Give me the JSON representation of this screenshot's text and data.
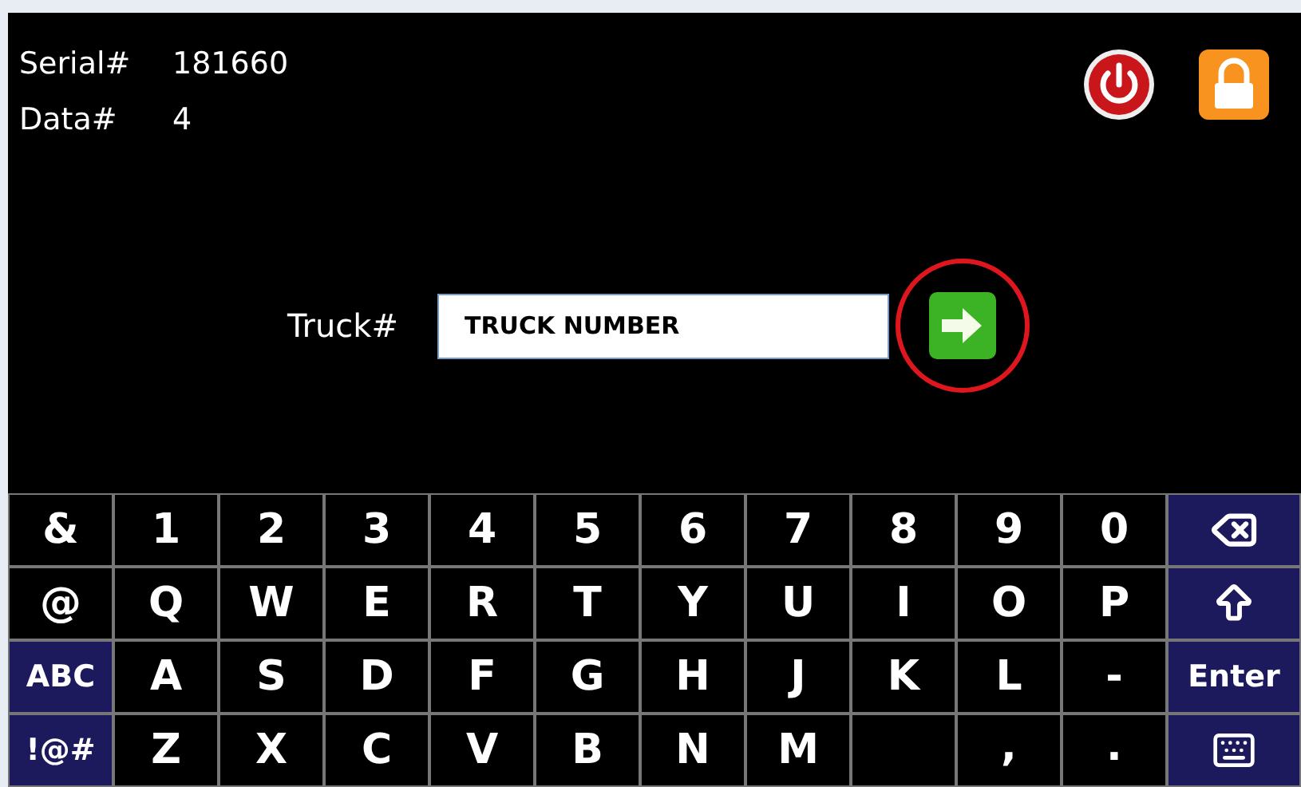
{
  "info": [
    {
      "label": "Serial#",
      "value": "181660"
    },
    {
      "label": "Data#",
      "value": "4"
    }
  ],
  "truck": {
    "label": "Truck#",
    "value": "TRUCK NUMBER"
  },
  "keyboard": [
    [
      {
        "kind": "char",
        "label": "&"
      },
      {
        "kind": "char",
        "label": "1"
      },
      {
        "kind": "char",
        "label": "2"
      },
      {
        "kind": "char",
        "label": "3"
      },
      {
        "kind": "char",
        "label": "4"
      },
      {
        "kind": "char",
        "label": "5"
      },
      {
        "kind": "char",
        "label": "6"
      },
      {
        "kind": "char",
        "label": "7"
      },
      {
        "kind": "char",
        "label": "8"
      },
      {
        "kind": "char",
        "label": "9"
      },
      {
        "kind": "char",
        "label": "0"
      },
      {
        "kind": "backspace"
      }
    ],
    [
      {
        "kind": "char",
        "label": "@"
      },
      {
        "kind": "char",
        "label": "Q"
      },
      {
        "kind": "char",
        "label": "W"
      },
      {
        "kind": "char",
        "label": "E"
      },
      {
        "kind": "char",
        "label": "R"
      },
      {
        "kind": "char",
        "label": "T"
      },
      {
        "kind": "char",
        "label": "Y"
      },
      {
        "kind": "char",
        "label": "U"
      },
      {
        "kind": "char",
        "label": "I"
      },
      {
        "kind": "char",
        "label": "O"
      },
      {
        "kind": "char",
        "label": "P"
      },
      {
        "kind": "shift"
      }
    ],
    [
      {
        "kind": "mode",
        "label": "ABC"
      },
      {
        "kind": "char",
        "label": "A"
      },
      {
        "kind": "char",
        "label": "S"
      },
      {
        "kind": "char",
        "label": "D"
      },
      {
        "kind": "char",
        "label": "F"
      },
      {
        "kind": "char",
        "label": "G"
      },
      {
        "kind": "char",
        "label": "H"
      },
      {
        "kind": "char",
        "label": "J"
      },
      {
        "kind": "char",
        "label": "K"
      },
      {
        "kind": "char",
        "label": "L"
      },
      {
        "kind": "char",
        "label": "-"
      },
      {
        "kind": "mode",
        "label": "Enter"
      }
    ],
    [
      {
        "kind": "mode",
        "label": "!@#"
      },
      {
        "kind": "char",
        "label": "Z"
      },
      {
        "kind": "char",
        "label": "X"
      },
      {
        "kind": "char",
        "label": "C"
      },
      {
        "kind": "char",
        "label": "V"
      },
      {
        "kind": "char",
        "label": "B"
      },
      {
        "kind": "char",
        "label": "N"
      },
      {
        "kind": "char",
        "label": "M"
      },
      {
        "kind": "blank"
      },
      {
        "kind": "low",
        "label": ","
      },
      {
        "kind": "low",
        "label": "."
      },
      {
        "kind": "hide"
      }
    ]
  ]
}
